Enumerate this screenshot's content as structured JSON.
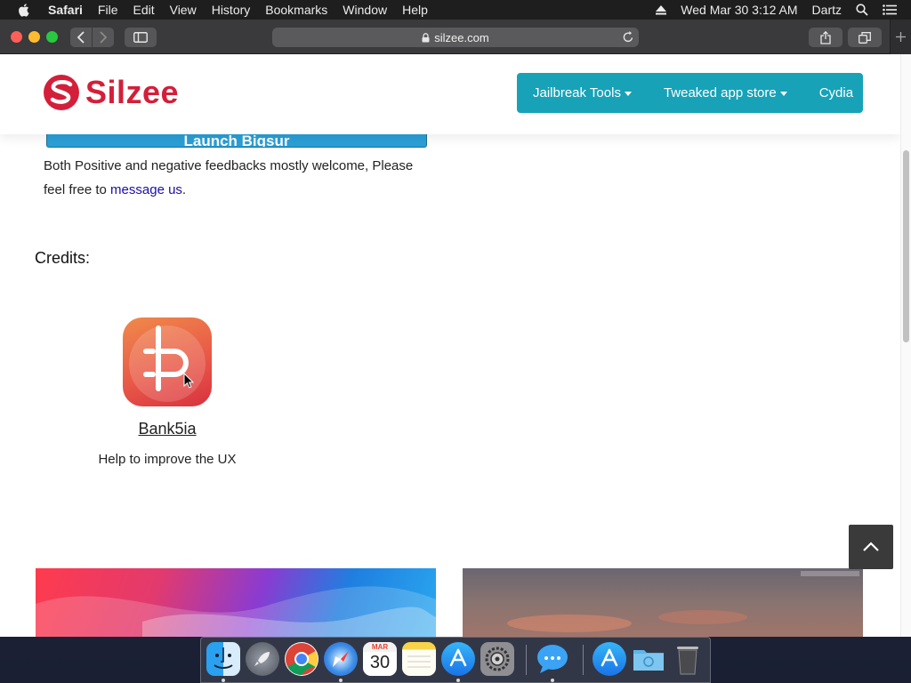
{
  "menubar": {
    "app_name": "Safari",
    "menus": [
      "File",
      "Edit",
      "View",
      "History",
      "Bookmarks",
      "Window",
      "Help"
    ],
    "clock": "Wed Mar 30  3:12 AM",
    "user": "Dartz"
  },
  "browser": {
    "url": "silzee.com"
  },
  "site": {
    "logo_text": "Silzee",
    "nav": [
      {
        "label": "Jailbreak Tools",
        "has_dropdown": true
      },
      {
        "label": "Tweaked app store",
        "has_dropdown": true
      },
      {
        "label": "Cydia",
        "has_dropdown": false
      }
    ],
    "launch_button_label": "Launch Bigsur",
    "feedback_text": "Both Positive and negative feedbacks mostly welcome, Please feel free to ",
    "feedback_link": "message us",
    "feedback_end": ".",
    "credits_heading": "Credits:",
    "credit": {
      "name": "Bank5ia",
      "role": "Help to improve the UX"
    }
  },
  "dock": {
    "calendar_month": "MAR",
    "calendar_day": "30",
    "apps": [
      "finder-icon",
      "launchpad-icon",
      "chrome-icon",
      "safari-icon",
      "calendar-icon",
      "notes-icon",
      "app-store-icon",
      "system-preferences-icon",
      "messages-icon",
      "app-store-folder-icon",
      "downloads-folder-icon",
      "trash-icon"
    ]
  },
  "colors": {
    "brand_red": "#d31f3a",
    "nav_teal": "#17a2b8",
    "link_blue": "#1a0dab"
  }
}
